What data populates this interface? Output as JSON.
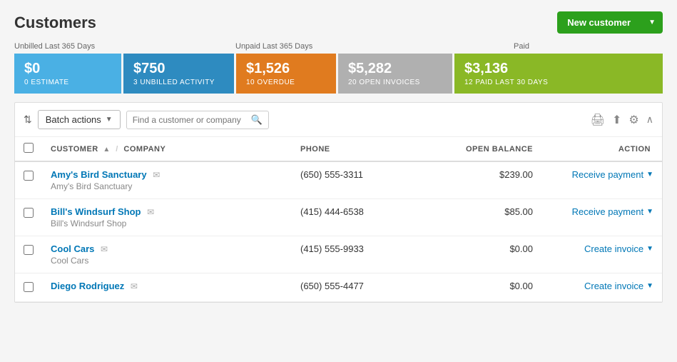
{
  "page": {
    "title": "Customers"
  },
  "header": {
    "new_customer_label": "New customer"
  },
  "stats": {
    "unbilled_label": "Unbilled Last 365 Days",
    "unpaid_label": "Unpaid Last 365 Days",
    "paid_label": "Paid",
    "cards": [
      {
        "amount": "$0",
        "label": "0 ESTIMATE",
        "color": "blue"
      },
      {
        "amount": "$750",
        "label": "3 UNBILLED ACTIVITY",
        "color": "blue-dark"
      },
      {
        "amount": "$1,526",
        "label": "10 OVERDUE",
        "color": "orange"
      },
      {
        "amount": "$5,282",
        "label": "20 OPEN INVOICES",
        "color": "gray"
      },
      {
        "amount": "$3,136",
        "label": "12 PAID LAST 30 DAYS",
        "color": "green"
      }
    ]
  },
  "toolbar": {
    "batch_actions_label": "Batch actions",
    "search_placeholder": "Find a customer or company"
  },
  "table": {
    "columns": [
      {
        "key": "customer",
        "label": "CUSTOMER",
        "sortable": true
      },
      {
        "key": "company",
        "label": "COMPANY",
        "sortable": false
      },
      {
        "key": "phone",
        "label": "PHONE",
        "sortable": false
      },
      {
        "key": "open_balance",
        "label": "OPEN BALANCE",
        "sortable": false
      },
      {
        "key": "action",
        "label": "ACTION",
        "sortable": false
      }
    ],
    "rows": [
      {
        "name": "Amy's Bird Sanctuary",
        "has_email": true,
        "company": "Amy's Bird Sanctuary",
        "phone": "(650) 555-3311",
        "open_balance": "$239.00",
        "action_label": "Receive payment",
        "action_has_dropdown": true
      },
      {
        "name": "Bill's Windsurf Shop",
        "has_email": true,
        "company": "Bill's Windsurf Shop",
        "phone": "(415) 444-6538",
        "open_balance": "$85.00",
        "action_label": "Receive payment",
        "action_has_dropdown": true
      },
      {
        "name": "Cool Cars",
        "has_email": true,
        "company": "Cool Cars",
        "phone": "(415) 555-9933",
        "open_balance": "$0.00",
        "action_label": "Create invoice",
        "action_has_dropdown": true
      },
      {
        "name": "Diego Rodriguez",
        "has_email": true,
        "company": "",
        "phone": "(650) 555-4477",
        "open_balance": "$0.00",
        "action_label": "Create invoice",
        "action_has_dropdown": true
      }
    ]
  },
  "icons": {
    "sort": "⇅",
    "dropdown_arrow": "▼",
    "search": "🔍",
    "email": "✉",
    "print": "🖨",
    "export": "⬆",
    "settings": "⚙",
    "scroll_up": "∧"
  }
}
